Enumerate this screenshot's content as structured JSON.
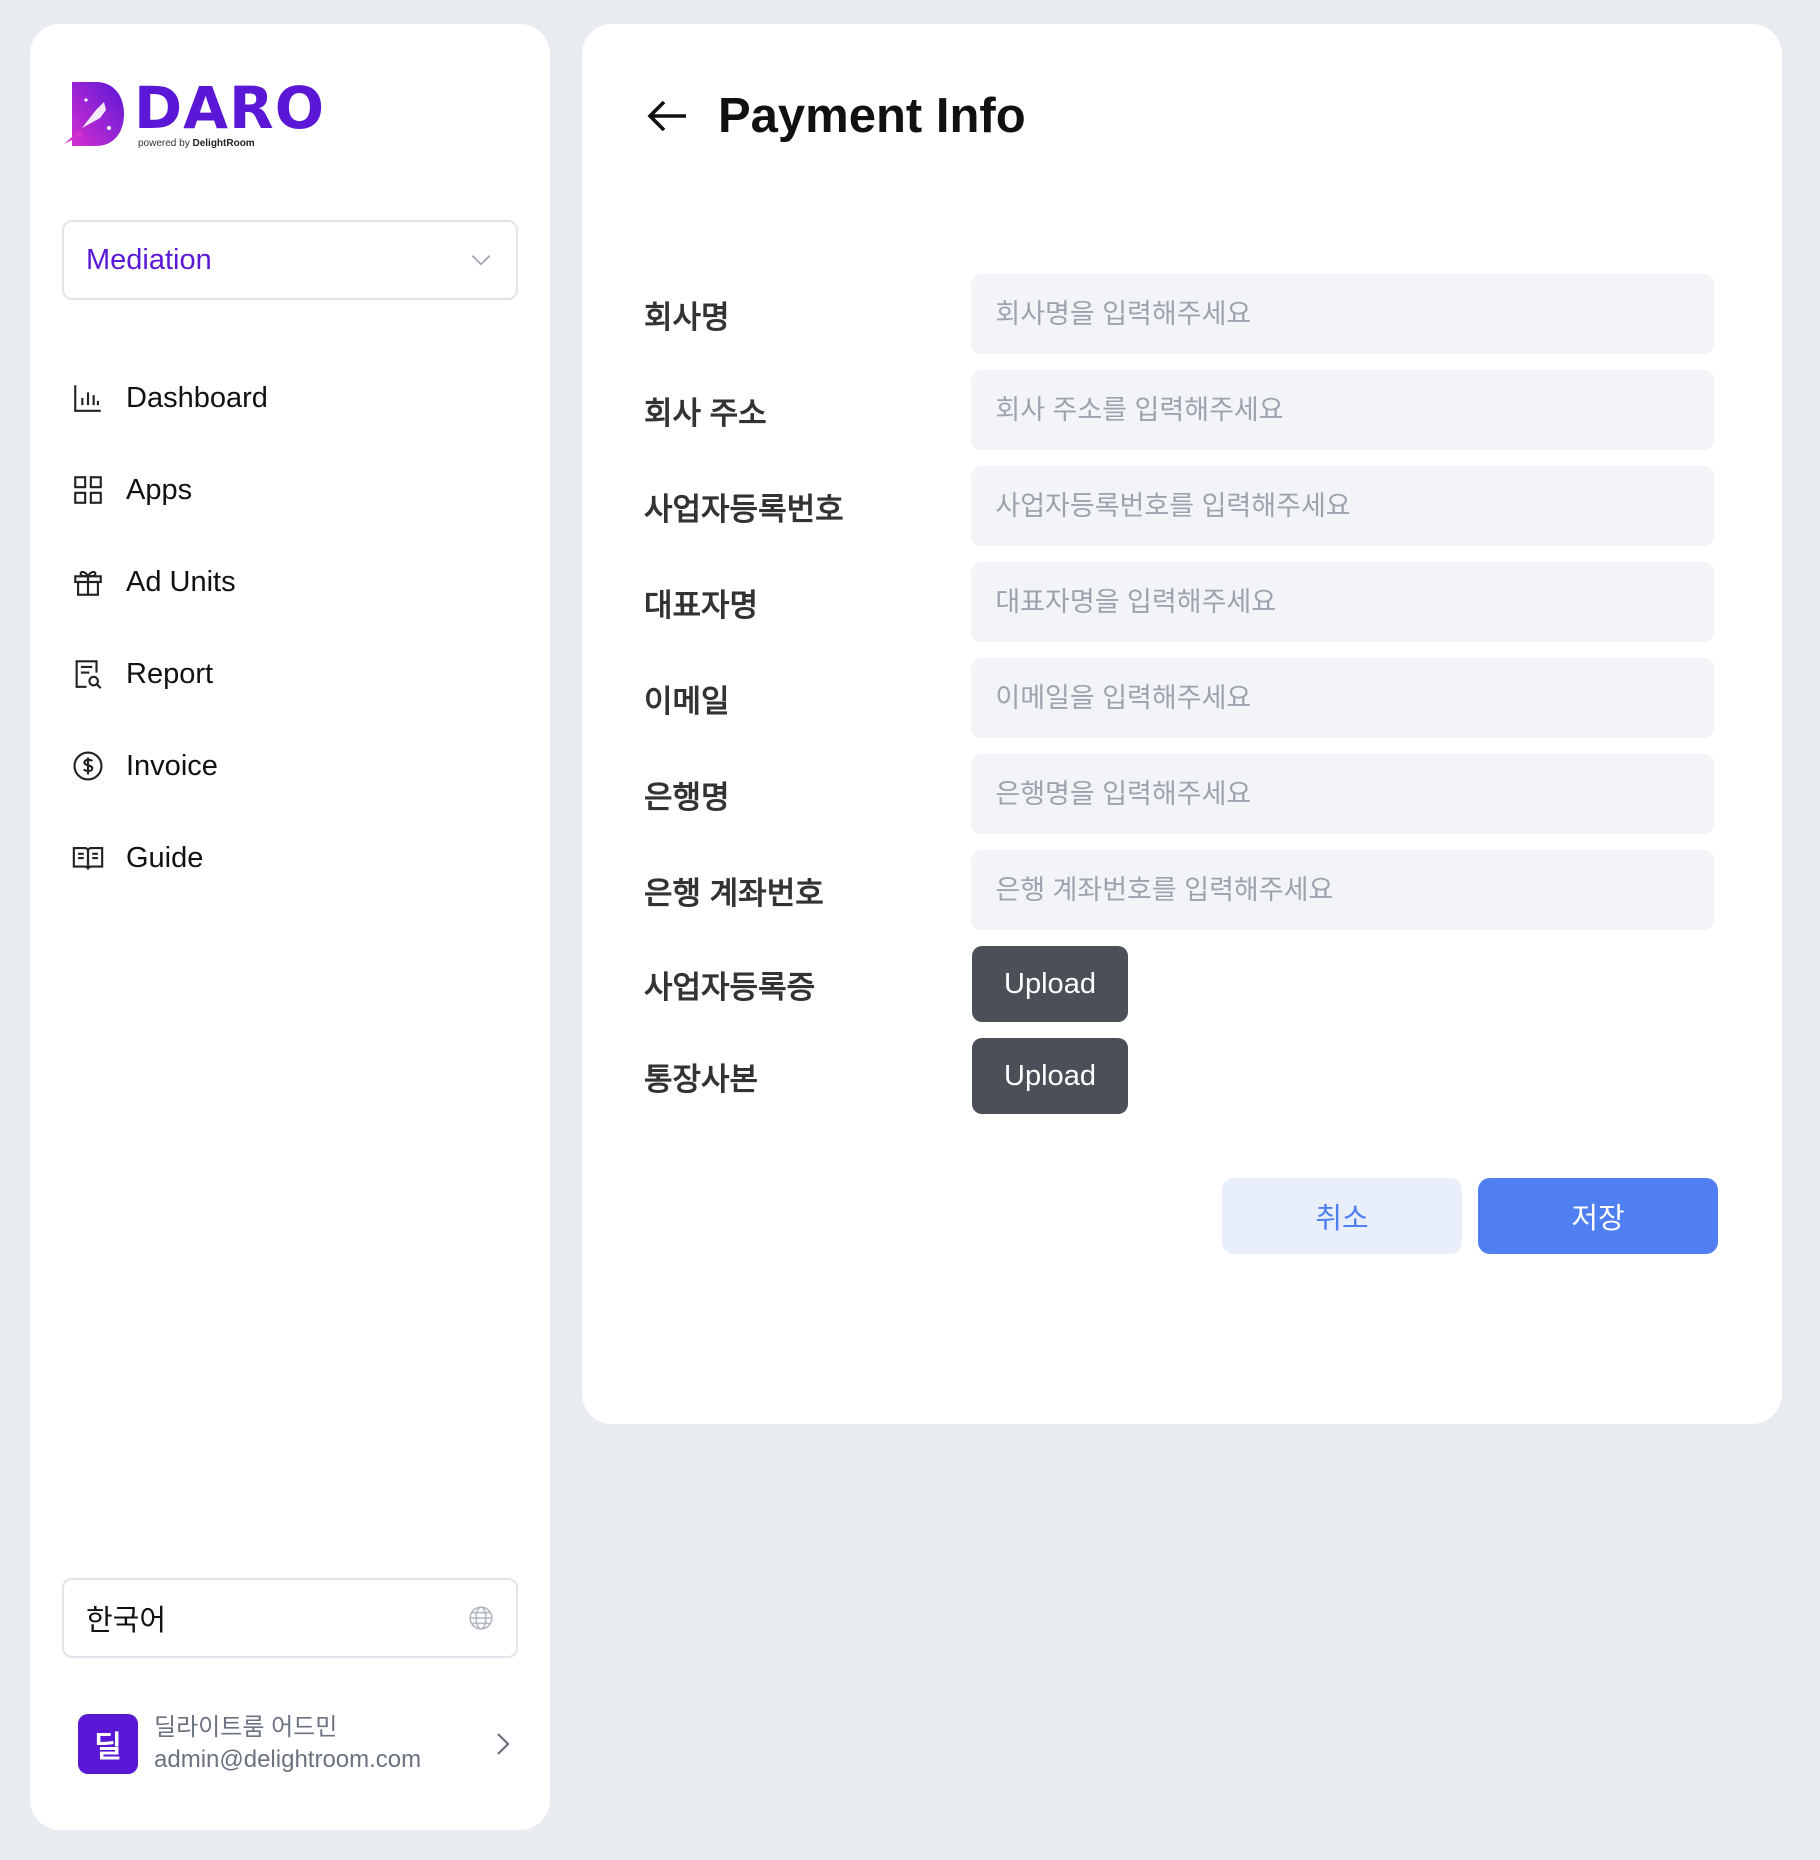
{
  "brand": {
    "name": "DARO",
    "powered_prefix": "powered by",
    "powered_company": "DelightRoom"
  },
  "sidebar": {
    "mode_select": "Mediation",
    "items": [
      {
        "label": "Dashboard",
        "icon": "bar-chart-icon"
      },
      {
        "label": "Apps",
        "icon": "grid-icon"
      },
      {
        "label": "Ad Units",
        "icon": "gift-icon"
      },
      {
        "label": "Report",
        "icon": "report-search-icon"
      },
      {
        "label": "Invoice",
        "icon": "dollar-circle-icon"
      },
      {
        "label": "Guide",
        "icon": "book-icon"
      }
    ],
    "language": "한국어",
    "user": {
      "initial": "딜",
      "name": "딜라이트룸 어드민",
      "email": "admin@delightroom.com"
    }
  },
  "page": {
    "title": "Payment Info"
  },
  "form": {
    "fields": [
      {
        "label": "회사명",
        "value": "",
        "placeholder": "회사명을 입력해주세요"
      },
      {
        "label": "회사 주소",
        "value": "",
        "placeholder": "회사 주소를 입력해주세요"
      },
      {
        "label": "사업자등록번호",
        "value": "",
        "placeholder": "사업자등록번호를 입력해주세요"
      },
      {
        "label": "대표자명",
        "value": "",
        "placeholder": "대표자명을 입력해주세요"
      },
      {
        "label": "이메일",
        "value": "",
        "placeholder": "이메일을 입력해주세요"
      },
      {
        "label": "은행명",
        "value": "",
        "placeholder": "은행명을 입력해주세요"
      },
      {
        "label": "은행 계좌번호",
        "value": "",
        "placeholder": "은행 계좌번호를 입력해주세요"
      }
    ],
    "uploads": [
      {
        "label": "사업자등록증",
        "button": "Upload"
      },
      {
        "label": "통장사본",
        "button": "Upload"
      }
    ],
    "cancel_label": "취소",
    "save_label": "저장"
  },
  "colors": {
    "brand": "#5a18d6",
    "primary": "#4f7ff0",
    "upload": "#4b5058"
  }
}
